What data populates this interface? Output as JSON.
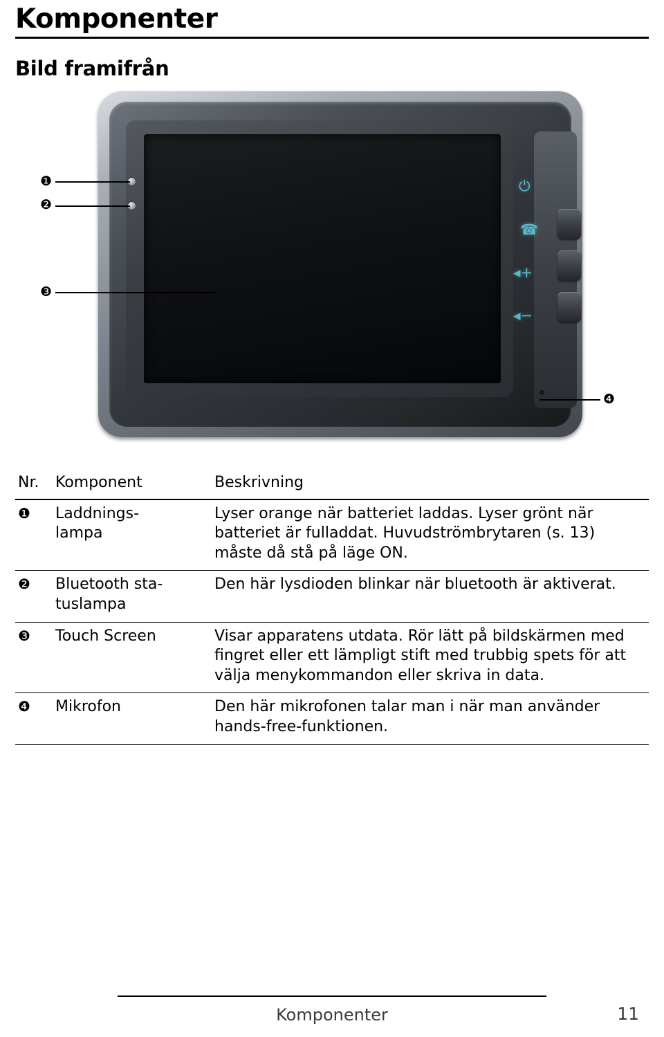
{
  "header": {
    "chapter_title": "Komponenter",
    "section_title": "Bild framifrån"
  },
  "figure": {
    "callouts": [
      {
        "marker": "❶",
        "target": "laddningslampa"
      },
      {
        "marker": "❷",
        "target": "bluetooth-statuslampa"
      },
      {
        "marker": "❸",
        "target": "touch-screen"
      },
      {
        "marker": "❹",
        "target": "mikrofon"
      }
    ],
    "button_glyphs": [
      {
        "name": "power-icon",
        "glyph": "⏻"
      },
      {
        "name": "call-icon",
        "glyph": "☎"
      },
      {
        "name": "volume-up-icon",
        "glyph": "◂+"
      },
      {
        "name": "volume-down-icon",
        "glyph": "◂−"
      }
    ]
  },
  "table": {
    "headers": {
      "nr": "Nr.",
      "component": "Komponent",
      "description": "Beskrivning"
    },
    "rows": [
      {
        "marker": "❶",
        "component": "Laddnings-\nlampa",
        "description": "Lyser orange när batteriet laddas. Lyser grönt när batteriet är fulladdat. Huvudströmbrytaren (s. 13) måste då stå på läge ON."
      },
      {
        "marker": "❷",
        "component": "Bluetooth sta-\ntuslampa",
        "description": "Den här lysdioden blinkar när bluetooth är aktiverat."
      },
      {
        "marker": "❸",
        "component": "Touch Screen",
        "description": "Visar apparatens utdata. Rör lätt på bildskärmen med fingret eller ett lämpligt stift med trubbig spets för att välja menykommandon eller skriva in data."
      },
      {
        "marker": "❹",
        "component": "Mikrofon",
        "description": "Den här mikrofonen talar man i när man använder hands-free-funktionen."
      }
    ]
  },
  "footer": {
    "label": "Komponenter",
    "page_number": "11"
  }
}
